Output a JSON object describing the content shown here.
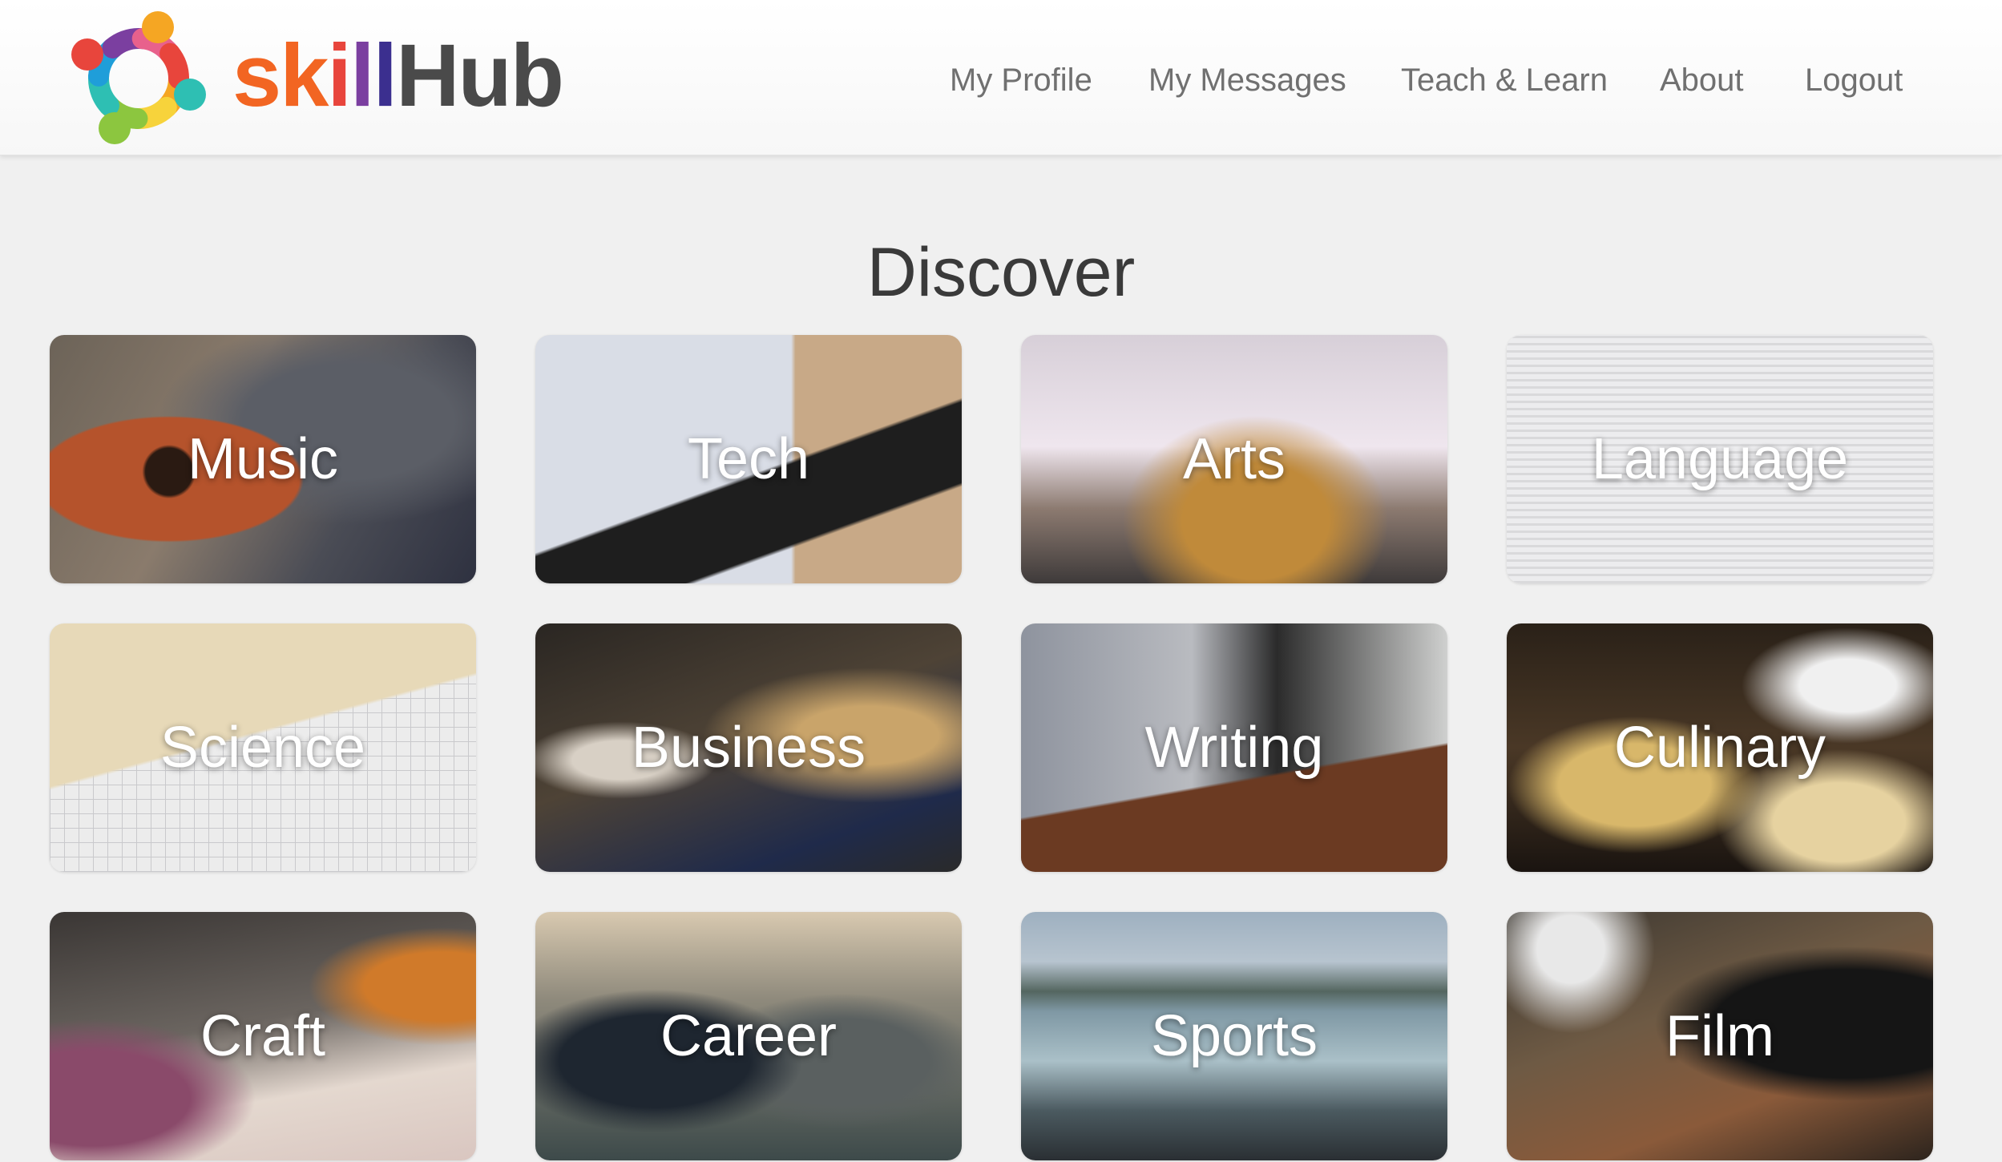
{
  "header": {
    "brand": {
      "letters": [
        {
          "text": "s",
          "color": "#f26522"
        },
        {
          "text": "k",
          "color": "#f26522"
        },
        {
          "text": "i",
          "color": "#e8453c"
        },
        {
          "text": "l",
          "color": "#7b3fa0"
        },
        {
          "text": "l",
          "color": "#3b2f8f"
        },
        {
          "text": "Hub",
          "color": "#4a4a4a"
        }
      ]
    },
    "nav": [
      {
        "label": "My Profile"
      },
      {
        "label": "My Messages"
      },
      {
        "label": "Teach & Learn"
      },
      {
        "label": "About"
      },
      {
        "label": "Logout"
      }
    ]
  },
  "main": {
    "title": "Discover",
    "categories": [
      {
        "label": "Music",
        "icon": "guitar-photo"
      },
      {
        "label": "Tech",
        "icon": "laptop-photo"
      },
      {
        "label": "Arts",
        "icon": "painted-building-photo"
      },
      {
        "label": "Language",
        "icon": "dictionary-photo"
      },
      {
        "label": "Science",
        "icon": "notebook-photo"
      },
      {
        "label": "Business",
        "icon": "meeting-photo"
      },
      {
        "label": "Writing",
        "icon": "writing-photo"
      },
      {
        "label": "Culinary",
        "icon": "bread-basket-photo"
      },
      {
        "label": "Craft",
        "icon": "craft-table-photo"
      },
      {
        "label": "Career",
        "icon": "business-people-photo"
      },
      {
        "label": "Sports",
        "icon": "surfers-photo"
      },
      {
        "label": "Film",
        "icon": "camera-photo"
      }
    ]
  },
  "colors": {
    "page_background": "#f0f0f0",
    "header_background": "#ffffff",
    "nav_text": "#707070",
    "title_text": "#3a3a3a",
    "logo_ring": [
      "#e8453c",
      "#f5a623",
      "#f7d33b",
      "#8cc63f",
      "#2ebfb3",
      "#1f9ed9",
      "#7b3fa0",
      "#e8618c"
    ]
  }
}
